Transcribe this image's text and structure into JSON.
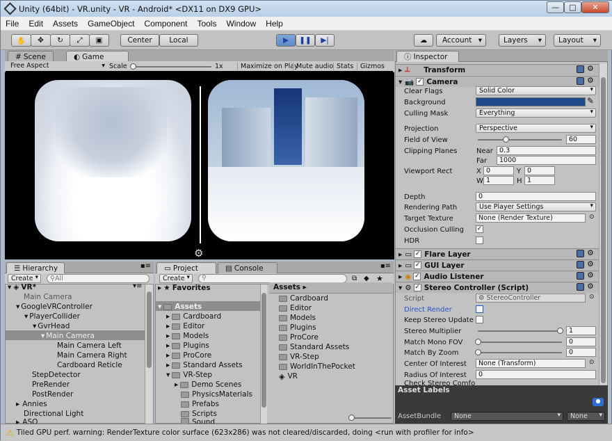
{
  "window": {
    "title": "Unity (64bit) - VR.unity - VR - Android* <DX11 on DX9 GPU>",
    "min": "—",
    "max": "□",
    "close": "✕"
  },
  "menu": [
    "File",
    "Edit",
    "Assets",
    "GameObject",
    "Component",
    "Tools",
    "Window",
    "Help"
  ],
  "toolbar": {
    "center": "Center",
    "local": "Local",
    "account": "Account",
    "layers": "Layers",
    "layout": "Layout"
  },
  "tabs": {
    "scene": "Scene",
    "game": "Game",
    "inspector": "Inspector",
    "hierarchy": "Hierarchy",
    "project": "Project",
    "console": "Console"
  },
  "game_bar": {
    "aspect": "Free Aspect",
    "scale_label": "Scale",
    "scale_value": "1x",
    "maximize": "Maximize on Play",
    "mute": "Mute audio",
    "stats": "Stats",
    "gizmos": "Gizmos"
  },
  "inspector": {
    "transform": "Transform",
    "camera": "Camera",
    "clear_flags_label": "Clear Flags",
    "clear_flags": "Solid Color",
    "background_label": "Background",
    "background_color": "#1f4a8a",
    "culling_mask_label": "Culling Mask",
    "culling_mask": "Everything",
    "projection_label": "Projection",
    "projection": "Perspective",
    "fov_label": "Field of View",
    "fov": "60",
    "clipping_label": "Clipping Planes",
    "near_label": "Near",
    "near": "0.3",
    "far_label": "Far",
    "far": "1000",
    "viewport_label": "Viewport Rect",
    "vx_label": "X",
    "vx": "0",
    "vy_label": "Y",
    "vy": "0",
    "vw_label": "W",
    "vw": "1",
    "vh_label": "H",
    "vh": "1",
    "depth_label": "Depth",
    "depth": "0",
    "rendering_path_label": "Rendering Path",
    "rendering_path": "Use Player Settings",
    "target_texture_label": "Target Texture",
    "target_texture": "None (Render Texture)",
    "occlusion_label": "Occlusion Culling",
    "hdr_label": "HDR",
    "flare_layer": "Flare Layer",
    "gui_layer": "GUI Layer",
    "audio_listener": "Audio Listener",
    "stereo_controller": "Stereo Controller (Script)",
    "script_label": "Script",
    "script": "StereoController",
    "direct_render_label": "Direct Render",
    "keep_stereo_label": "Keep Stereo Update",
    "stereo_mult_label": "Stereo Multiplier",
    "stereo_mult": "1",
    "match_mono_label": "Match Mono FOV",
    "match_mono": "0",
    "match_zoom_label": "Match By Zoom",
    "match_zoom": "0",
    "center_interest_label": "Center Of Interest",
    "center_interest": "None (Transform)",
    "radius_label": "Radius Of Interest",
    "radius": "0",
    "check_stereo_label": "Check Stereo Comfo",
    "asset_labels": "Asset Labels",
    "assetbundle_label": "AssetBundle",
    "assetbundle": "None",
    "assetbundle_variant": "None"
  },
  "hierarchy": {
    "create": "Create",
    "search_placeholder": "All",
    "items": [
      {
        "label": "VR*",
        "indent": 0
      },
      {
        "label": "Main Camera",
        "indent": 1
      },
      {
        "label": "GoogleVRController",
        "indent": 1
      },
      {
        "label": "PlayerCollider",
        "indent": 2
      },
      {
        "label": "GvrHead",
        "indent": 3
      },
      {
        "label": "Main Camera",
        "indent": 4
      },
      {
        "label": "Main Camera Left",
        "indent": 5
      },
      {
        "label": "Main Camera Right",
        "indent": 5
      },
      {
        "label": "Cardboard Reticle",
        "indent": 5
      },
      {
        "label": "StepDetector",
        "indent": 2
      },
      {
        "label": "PreRender",
        "indent": 2
      },
      {
        "label": "PostRender",
        "indent": 2
      },
      {
        "label": "Annies",
        "indent": 1
      },
      {
        "label": "Directional Light",
        "indent": 1
      },
      {
        "label": "ASO",
        "indent": 1
      }
    ]
  },
  "project": {
    "create": "Create",
    "favorites": "Favorites",
    "assets_root": "Assets",
    "tree": [
      "Cardboard",
      "Editor",
      "Models",
      "Plugins",
      "ProCore",
      "Standard Assets",
      "VR-Step",
      "Demo Scenes",
      "PhysicsMaterials",
      "Prefabs",
      "Scripts",
      "Sound"
    ],
    "breadcrumb": "Assets",
    "list": [
      "Cardboard",
      "Editor",
      "Models",
      "Plugins",
      "ProCore",
      "Standard Assets",
      "VR-Step",
      "WorldInThePocket",
      "VR"
    ]
  },
  "status": {
    "message": "Tiled GPU perf. warning: RenderTexture color surface  (623x286) was not cleared/discarded, doing <run with profiler for info>"
  }
}
